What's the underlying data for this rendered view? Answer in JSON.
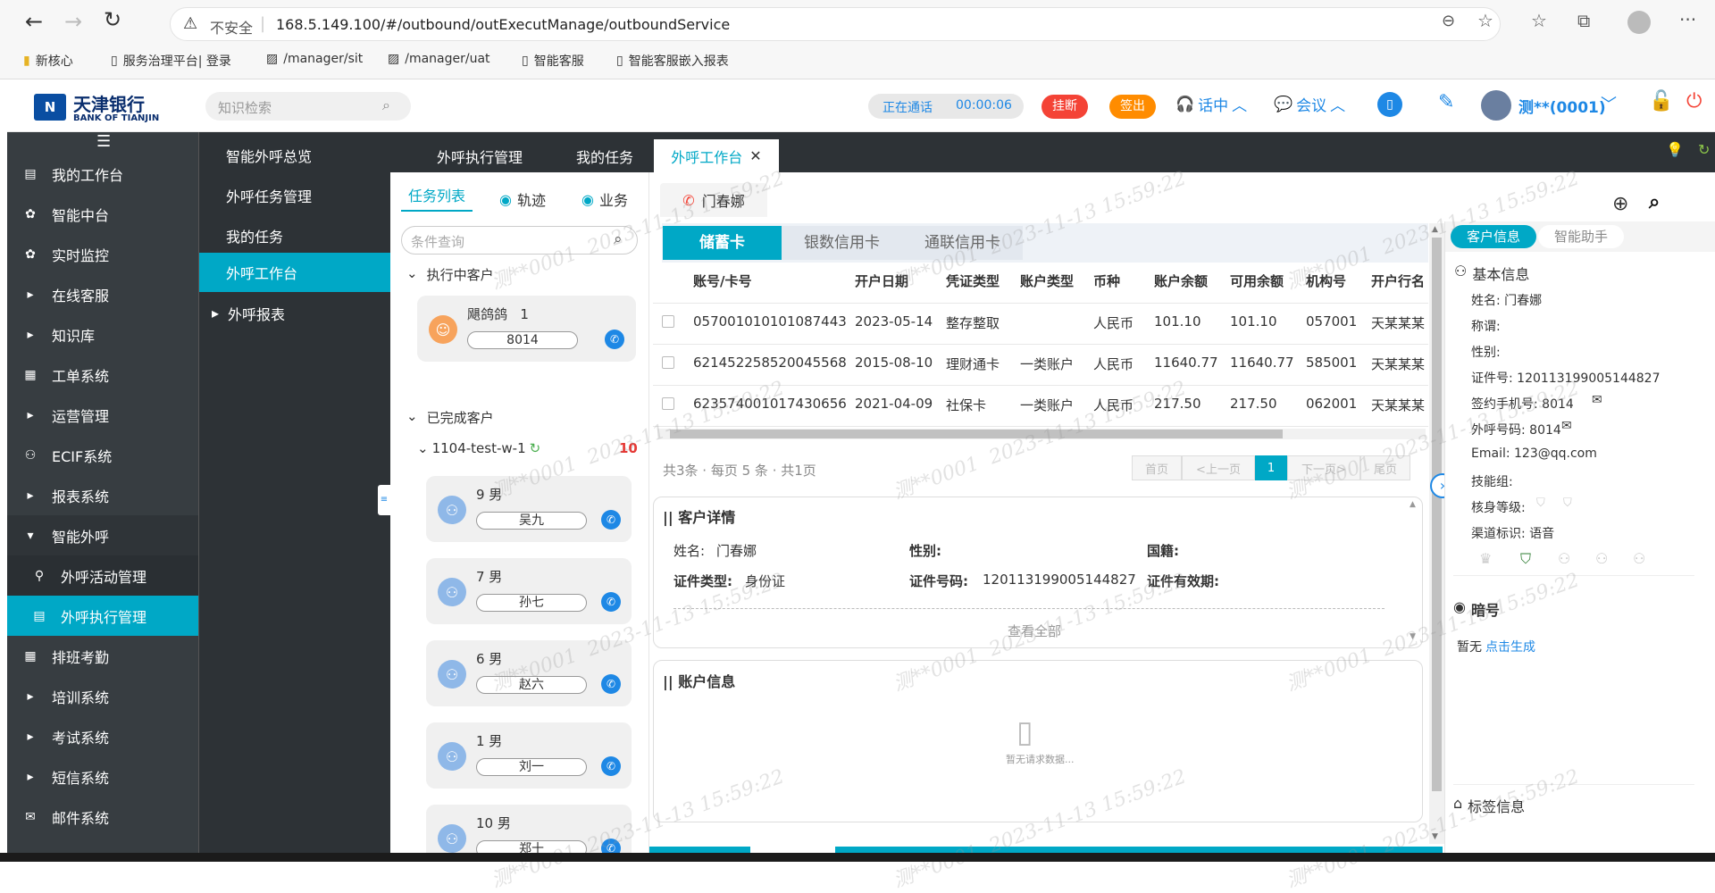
{
  "browser": {
    "security_label": "不安全",
    "url": "168.5.149.100/#/outbound/outExecutManage/outboundService",
    "bookmarks": [
      "新核心",
      "服务治理平台| 登录",
      "/manager/sit",
      "/manager/uat",
      "智能客服",
      "智能客服嵌入报表"
    ]
  },
  "header": {
    "brand_cn": "天津银行",
    "brand_en": "BANK OF TIANJIN",
    "search_placeholder": "知识检索",
    "call_status": "正在通话",
    "call_timer": "00:00:06",
    "hangup_label": "挂断",
    "checkout_label": "签出",
    "talking_label": "话中",
    "meeting_label": "会议",
    "user_label": "测**(0001)"
  },
  "leftnav": {
    "items": [
      {
        "label": "我的工作台",
        "icon": "monitor-icon"
      },
      {
        "label": "智能中台",
        "icon": "gear-icon"
      },
      {
        "label": "实时监控",
        "icon": "gear-icon"
      },
      {
        "label": "在线客服",
        "icon": "caret-right-icon"
      },
      {
        "label": "知识库",
        "icon": "caret-right-icon"
      },
      {
        "label": "工单系统",
        "icon": "clipboard-icon"
      },
      {
        "label": "运营管理",
        "icon": "caret-right-icon"
      },
      {
        "label": "ECIF系统",
        "icon": "user-icon"
      },
      {
        "label": "报表系统",
        "icon": "caret-right-icon"
      },
      {
        "label": "智能外呼",
        "icon": "caret-down-icon"
      },
      {
        "label": "外呼活动管理",
        "icon": "search-user-icon"
      },
      {
        "label": "外呼执行管理",
        "icon": "document-icon"
      },
      {
        "label": "排班考勤",
        "icon": "table-icon"
      },
      {
        "label": "培训系统",
        "icon": "caret-right-icon"
      },
      {
        "label": "考试系统",
        "icon": "caret-right-icon"
      },
      {
        "label": "短信系统",
        "icon": "caret-right-icon"
      },
      {
        "label": "邮件系统",
        "icon": "mail-icon"
      }
    ]
  },
  "subnav": {
    "items": [
      "智能外呼总览",
      "外呼任务管理",
      "我的任务",
      "外呼工作台",
      "外呼报表"
    ]
  },
  "tabs": [
    "外呼执行管理",
    "我的任务",
    "外呼工作台"
  ],
  "taskpanel": {
    "tabs": [
      "任务列表",
      "轨迹",
      "业务"
    ],
    "search_placeholder": "条件查询",
    "executing_title": "执行中客户",
    "executing_card": {
      "name": "飓鸽鸽",
      "count": "1",
      "ext": "8014"
    },
    "completed_title": "已完成客户",
    "group_name": "1104-test-w-1",
    "group_count": "10",
    "completed_cards": [
      {
        "info": "9   男",
        "name": "吴九"
      },
      {
        "info": "7   男",
        "name": "孙七"
      },
      {
        "info": "6   男",
        "name": "赵六"
      },
      {
        "info": "1   男",
        "name": "刘一"
      },
      {
        "info": "10   男",
        "name": "郑十"
      }
    ]
  },
  "main": {
    "caller_name": "门春娜",
    "card_tabs": [
      "储蓄卡",
      "银数信用卡",
      "通联信用卡"
    ],
    "table_headers": [
      "账号/卡号",
      "开户日期",
      "凭证类型",
      "账户类型",
      "币种",
      "账户余额",
      "可用余额",
      "机构号",
      "开户行名"
    ],
    "rows": [
      [
        "057001010101087443",
        "2023-05-14",
        "整存整取",
        "",
        "人民币",
        "101.10",
        "101.10",
        "057001",
        "天某某某"
      ],
      [
        "621452258520045568",
        "2015-08-10",
        "理财通卡",
        "一类账户",
        "人民币",
        "11640.77",
        "11640.77",
        "585001",
        "天某某某"
      ],
      [
        "623574001017430656",
        "2021-04-09",
        "社保卡",
        "一类账户",
        "人民币",
        "217.50",
        "217.50",
        "062001",
        "天某某某"
      ]
    ],
    "pagination_info": "共3条 · 每页 5 条 · 共1页",
    "page_buttons": [
      "首页",
      "<上一页",
      "1",
      "下一页>",
      "尾页"
    ],
    "detail_title": "|| 客户详情",
    "detail": {
      "name_label": "姓名:",
      "name_value": "门春娜",
      "gender_label": "性别:",
      "nationality_label": "国籍:",
      "id_type_label": "证件类型:",
      "id_type_value": "身份证",
      "id_no_label": "证件号码:",
      "id_no_value": "120113199005144827",
      "id_valid_label": "证件有效期:"
    },
    "view_all": "查看全部",
    "account_title": "|| 账户信息",
    "empty_text": "暂无请求数据..."
  },
  "rightpanel": {
    "tabs": [
      "客户信息",
      "智能助手"
    ],
    "basic_title": "基本信息",
    "fields": [
      "姓名: 门春娜",
      "称谓:",
      "性别:",
      "证件号: 120113199005144827",
      "签约手机号: 8014",
      "外呼号码: 8014",
      "Email: 123@qq.com",
      "技能组:",
      "核身等级:",
      "渠道标识: 语音"
    ],
    "secret_title": "暗号",
    "secret_none": "暂无",
    "secret_generate": "点击生成",
    "tag_title": "标签信息"
  },
  "watermark": {
    "user": "测**0001",
    "time": "2023-11-13 15:59:22"
  },
  "colors": {
    "accent": "#00a8c6",
    "sidebar": "#373d41",
    "danger": "#f44336",
    "orange": "#ff8c00",
    "blue": "#1e88e5"
  }
}
